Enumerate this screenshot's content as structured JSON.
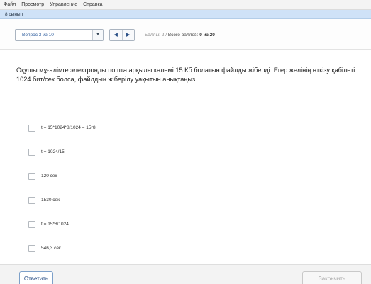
{
  "menu": {
    "items": [
      "Файл",
      "Просмотр",
      "Управление",
      "Справка"
    ]
  },
  "tab": {
    "label": "8 сынып"
  },
  "toolbar": {
    "question_select": "Вопрос 3 из 10",
    "prev_glyph": "◀",
    "next_glyph": "▶",
    "score_label": "Баллы:",
    "score_value": "2",
    "separator": "/",
    "total_label": "Всего баллов:",
    "total_value": "0 из 20"
  },
  "question": {
    "text": "Оқушы мұғалімге электронды пошта арқылы көлемі 15 Кб болатын файлды жіберді. Егер желінің өткізу қабілеті 1024 бит/сек болса, файлдың жіберілу уақытын анықтаңыз."
  },
  "options": [
    {
      "label": "t = 15*1024*8/1024 = 15*8"
    },
    {
      "label": "t = 1024/15"
    },
    {
      "label": "120 сек"
    },
    {
      "label": "1530 сек"
    },
    {
      "label": "t = 15*8/1024"
    },
    {
      "label": "546,3 сек"
    }
  ],
  "footer": {
    "answer_label": "Ответить",
    "finish_label": "Закончить"
  }
}
